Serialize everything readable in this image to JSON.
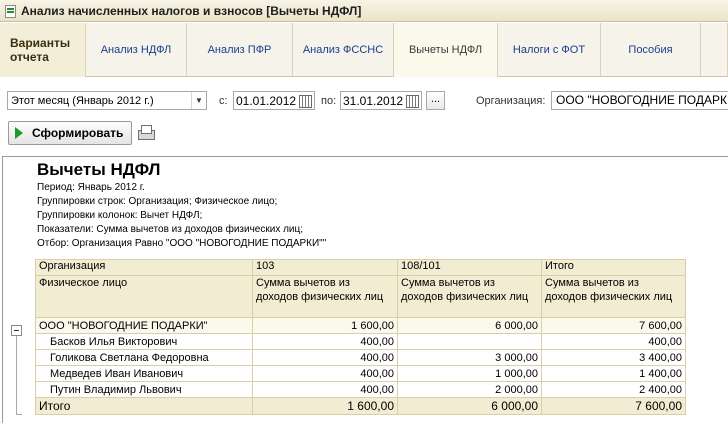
{
  "window": {
    "title": "Анализ начисленных налогов и взносов [Вычеты НДФЛ]"
  },
  "tabs": [
    {
      "label": "Варианты отчета"
    },
    {
      "label": "Анализ НДФЛ"
    },
    {
      "label": "Анализ ПФР"
    },
    {
      "label": "Анализ ФССНС"
    },
    {
      "label": "Вычеты НДФЛ"
    },
    {
      "label": "Налоги с ФОТ"
    },
    {
      "label": "Пособия"
    }
  ],
  "filters": {
    "period_select": "Этот месяц (Январь 2012 г.)",
    "from_label": "с:",
    "from_date": "01.01.2012",
    "to_label": "по:",
    "to_date": "31.01.2012",
    "dots_label": "...",
    "org_label": "Организация:",
    "org_value": "ООО \"НОВОГОДНИЕ ПОДАРКИ\""
  },
  "toolbar": {
    "form_button": "Сформировать"
  },
  "report": {
    "title": "Вычеты НДФЛ",
    "lines": [
      "Период: Январь 2012 г.",
      "Группировки строк: Организация; Физическое лицо;",
      "Группировки колонок: Вычет НДФЛ;",
      "Показатели: Сумма вычетов из доходов физических лиц;",
      "Отбор: Организация Равно \"ООО \"НОВОГОДНИЕ ПОДАРКИ\"\""
    ],
    "header_row1": [
      "Организация",
      "103",
      "108/101",
      "Итого"
    ],
    "header_row2": [
      "Физическое лицо",
      "Сумма вычетов из доходов физических лиц",
      "Сумма вычетов из доходов физических лиц",
      "Сумма вычетов из доходов физических лиц"
    ],
    "group_row": [
      "ООО \"НОВОГОДНИЕ ПОДАРКИ\"",
      "1 600,00",
      "6 000,00",
      "7 600,00"
    ],
    "rows": [
      [
        "Басков Илья Викторович",
        "400,00",
        "",
        "400,00"
      ],
      [
        "Голикова Светлана Федоровна",
        "400,00",
        "3 000,00",
        "3 400,00"
      ],
      [
        "Медведев Иван Иванович",
        "400,00",
        "1 000,00",
        "1 400,00"
      ],
      [
        "Путин Владимир Львович",
        "400,00",
        "2 000,00",
        "2 400,00"
      ]
    ],
    "total_row": [
      "Итого",
      "1 600,00",
      "6 000,00",
      "7 600,00"
    ]
  }
}
